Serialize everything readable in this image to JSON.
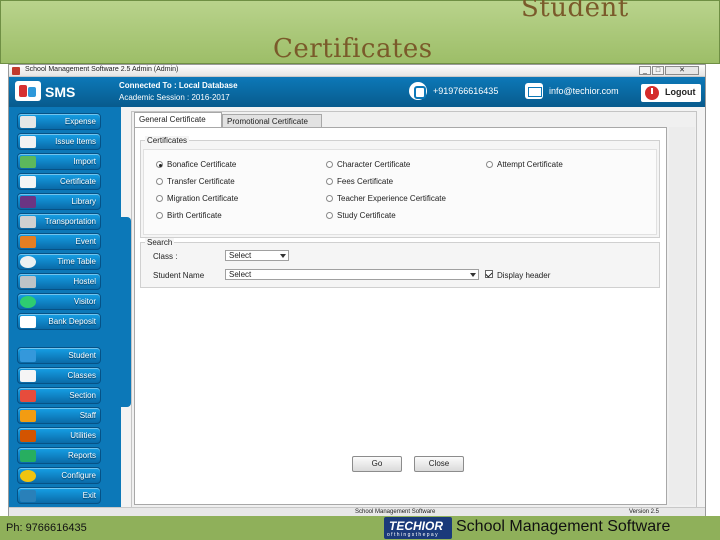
{
  "slide": {
    "title_line1": "Certificates",
    "title_line2": "Student",
    "footer_phone": "Ph: 9766616435",
    "footer_title": "School Management Software",
    "brand_name": "TECHIOR",
    "brand_tagline": "o f t h i n g s t h e p a y"
  },
  "window": {
    "title": "School Management Software 2.5    Admin (Admin)",
    "min": "_",
    "max": "□",
    "close": "✕"
  },
  "topbar": {
    "logo": "SMS",
    "database": "Connected To : Local Database",
    "session": "Academic Session : 2016-2017",
    "phone": "+919766616435",
    "email": "info@techior.com",
    "logout": "Logout"
  },
  "sidebar": {
    "items": [
      {
        "label": "Expense",
        "icon": "expense-icon"
      },
      {
        "label": "Issue Items",
        "icon": "issue-items-icon"
      },
      {
        "label": "Import",
        "icon": "import-icon"
      },
      {
        "label": "Certificate",
        "icon": "certificate-icon"
      },
      {
        "label": "Library",
        "icon": "library-icon"
      },
      {
        "label": "Transportation",
        "icon": "bus-icon"
      },
      {
        "label": "Event",
        "icon": "event-icon"
      },
      {
        "label": "Time Table",
        "icon": "clock-icon"
      },
      {
        "label": "Hostel",
        "icon": "hostel-icon"
      },
      {
        "label": "Visitor",
        "icon": "visitor-icon"
      },
      {
        "label": "Bank Deposit",
        "icon": "bank-icon"
      },
      {
        "label": "Student",
        "icon": "student-icon"
      },
      {
        "label": "Classes",
        "icon": "classes-icon"
      },
      {
        "label": "Section",
        "icon": "section-icon"
      },
      {
        "label": "Staff",
        "icon": "staff-icon"
      },
      {
        "label": "Utilities",
        "icon": "utilities-icon"
      },
      {
        "label": "Reports",
        "icon": "reports-icon"
      },
      {
        "label": "Configure",
        "icon": "gear-icon"
      },
      {
        "label": "Exit",
        "icon": "exit-icon"
      }
    ],
    "colors": {
      "sidebar": "#0c78b8",
      "button": "#16a0e6"
    }
  },
  "tabs": {
    "general": "General Certificate",
    "promotional": "Promotional Certificate"
  },
  "certificates": {
    "group_title": "Certificates",
    "options": [
      {
        "label": "Bonafice Certificate",
        "selected": true
      },
      {
        "label": "Character Certificate",
        "selected": false
      },
      {
        "label": "Attempt Certificate",
        "selected": false
      },
      {
        "label": "Transfer Certificate",
        "selected": false
      },
      {
        "label": "Fees Certificate",
        "selected": false
      },
      {
        "label": "Migration Certificate",
        "selected": false
      },
      {
        "label": "Teacher Experience Certificate",
        "selected": false
      },
      {
        "label": "Birth Certificate",
        "selected": false
      },
      {
        "label": "Study Certificate",
        "selected": false
      }
    ]
  },
  "search": {
    "group_title": "Search",
    "class_label": "Class :",
    "class_value": "Select",
    "student_label": "Student Name",
    "student_value": "Select",
    "display_header": "Display header"
  },
  "actions": {
    "go": "Go",
    "close": "Close"
  },
  "statusbar": {
    "left": "School Management Software",
    "right": "Version 2.5"
  }
}
